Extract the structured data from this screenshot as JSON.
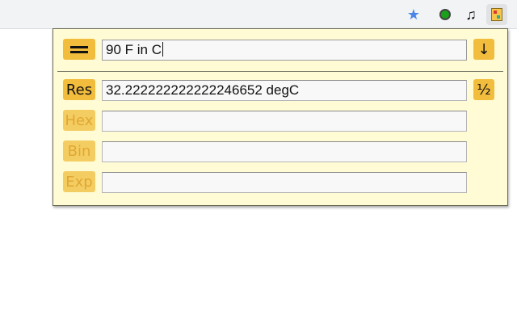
{
  "toolbar": {
    "icons": [
      "bookmark-star-icon",
      "green-extension-icon",
      "music-note-icon",
      "calculator-extension-icon"
    ],
    "star_glyph": "★",
    "music_glyph": "♫"
  },
  "calculator": {
    "equals_glyph": "",
    "expression": "90 F in C",
    "down_glyph": "↓",
    "half_glyph": "½",
    "rows": [
      {
        "label": "Res",
        "value": "32.222222222222246652 degC"
      },
      {
        "label": "Hex",
        "value": ""
      },
      {
        "label": "Bin",
        "value": ""
      },
      {
        "label": "Exp",
        "value": ""
      }
    ],
    "colors": {
      "popup_bg": "#fffbd4",
      "button": "#f2bd3d",
      "button_dim_text": "#e0a733"
    }
  }
}
